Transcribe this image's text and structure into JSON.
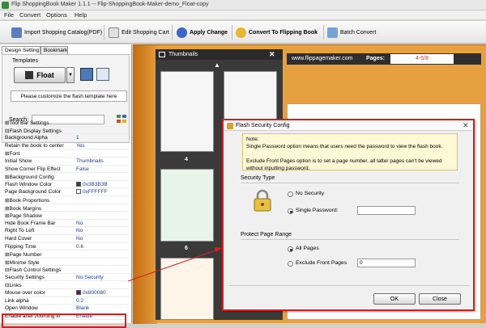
{
  "window": {
    "title": "Flip ShoppingBook Maker 1.1.1  -- Flip-ShoppingBook-Maker-demo_Float-copy"
  },
  "menu": [
    "File",
    "Convert",
    "Options",
    "Help"
  ],
  "toolbar": {
    "import": "Import Shopping Catalog(PDF)",
    "edit": "Edit Shopping Cart",
    "apply": "Apply Change",
    "convert": "Convert To Flipping Book",
    "batch": "Batch Convert"
  },
  "left": {
    "tabs": [
      "Design Setting",
      "Bookmark"
    ],
    "templates_label": "Templates",
    "template_name": "Float",
    "customize_label": "Please customize the flash template here",
    "search_label": "Search:",
    "props": [
      {
        "k": "⊞Tool Bar Settings",
        "v": ""
      },
      {
        "k": "⊟Flash Display Settings",
        "v": ""
      },
      {
        "k": "   Background Alpha",
        "v": "1"
      },
      {
        "k": "   Retain the book to center",
        "v": "Yes"
      },
      {
        "k": "⊞Font",
        "v": ""
      },
      {
        "k": "   Initial Show",
        "v": "Thumbnails"
      },
      {
        "k": "   Show Corner Flip Effect",
        "v": "False"
      },
      {
        "k": "⊞Background Config",
        "v": ""
      },
      {
        "k": "   Flash Window Color",
        "v": "0x3B3B3B",
        "c": "#3b3b3b"
      },
      {
        "k": "   Page Background Color",
        "v": "0xFFFFFF",
        "c": "#ffffff"
      },
      {
        "k": "⊞Book Proportions",
        "v": ""
      },
      {
        "k": "⊞Book Margins",
        "v": ""
      },
      {
        "k": "⊞Page Shadow",
        "v": ""
      },
      {
        "k": "   Hide Book Frame Bar",
        "v": "No"
      },
      {
        "k": "   Right To Left",
        "v": "No"
      },
      {
        "k": "   Hard Cover",
        "v": "No"
      },
      {
        "k": "   Flipping Time",
        "v": "0.6"
      },
      {
        "k": "⊞Page Number",
        "v": ""
      },
      {
        "k": "⊞Minime Style",
        "v": ""
      },
      {
        "k": "⊟Flash Control Settings",
        "v": ""
      },
      {
        "k": "   Security Settings",
        "v": "No Security"
      },
      {
        "k": "⊟Links",
        "v": ""
      },
      {
        "k": "   Mouse over color",
        "v": "0x800080",
        "c": "#800080"
      },
      {
        "k": "   Link alpha",
        "v": "0.2"
      },
      {
        "k": "   Open Window",
        "v": "Blank"
      },
      {
        "k": "   Enable after zooming in",
        "v": "Enable"
      }
    ]
  },
  "thumbnails": {
    "title": "Thumbnails",
    "nums": [
      "4",
      "6"
    ]
  },
  "flip": {
    "url": "www.flippagemaker.com",
    "pages_label": "Pages:",
    "pages_value": "4-5/8"
  },
  "dialog": {
    "title": "Flash Security Config",
    "note": "Note:\nSingle Password option means that users need the password to view the flash book.\n\nExclude Front Pages option is to set a page number, all latter pages can't be viewed without inputting password.",
    "security_type": "Security Type",
    "no_security": "No Security",
    "single_password": "Single Password:",
    "protect_range": "Protect Page Range",
    "all_pages": "All Pages",
    "exclude_front": "Exclude Front Pages",
    "exclude_value": "0",
    "ok": "OK",
    "close": "Close"
  },
  "colors": {
    "accent_red": "#d42020",
    "book_bg": "#e7a040"
  }
}
